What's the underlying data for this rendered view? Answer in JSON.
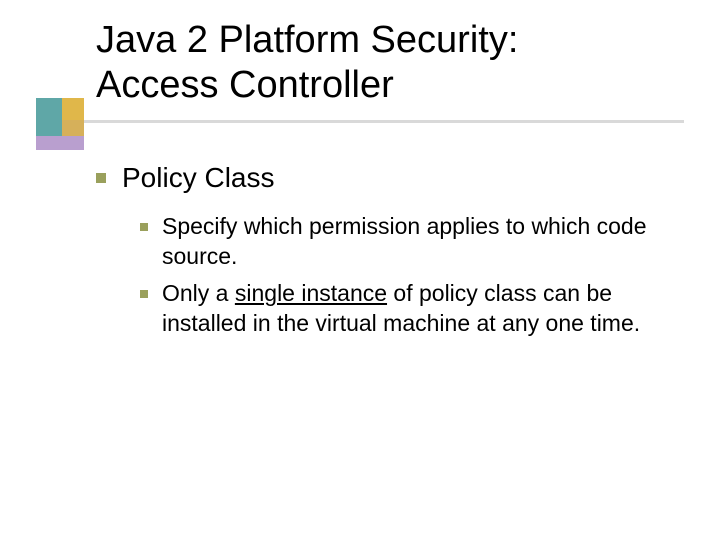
{
  "title_line1": "Java 2 Platform Security:",
  "title_line2": "Access Controller",
  "body": {
    "item1": "Policy Class",
    "sub1": "Specify which permission applies to which code source.",
    "sub2_a": "Only a ",
    "sub2_u": "single instance",
    "sub2_b": " of policy class can be installed in the virtual machine at any one time."
  }
}
